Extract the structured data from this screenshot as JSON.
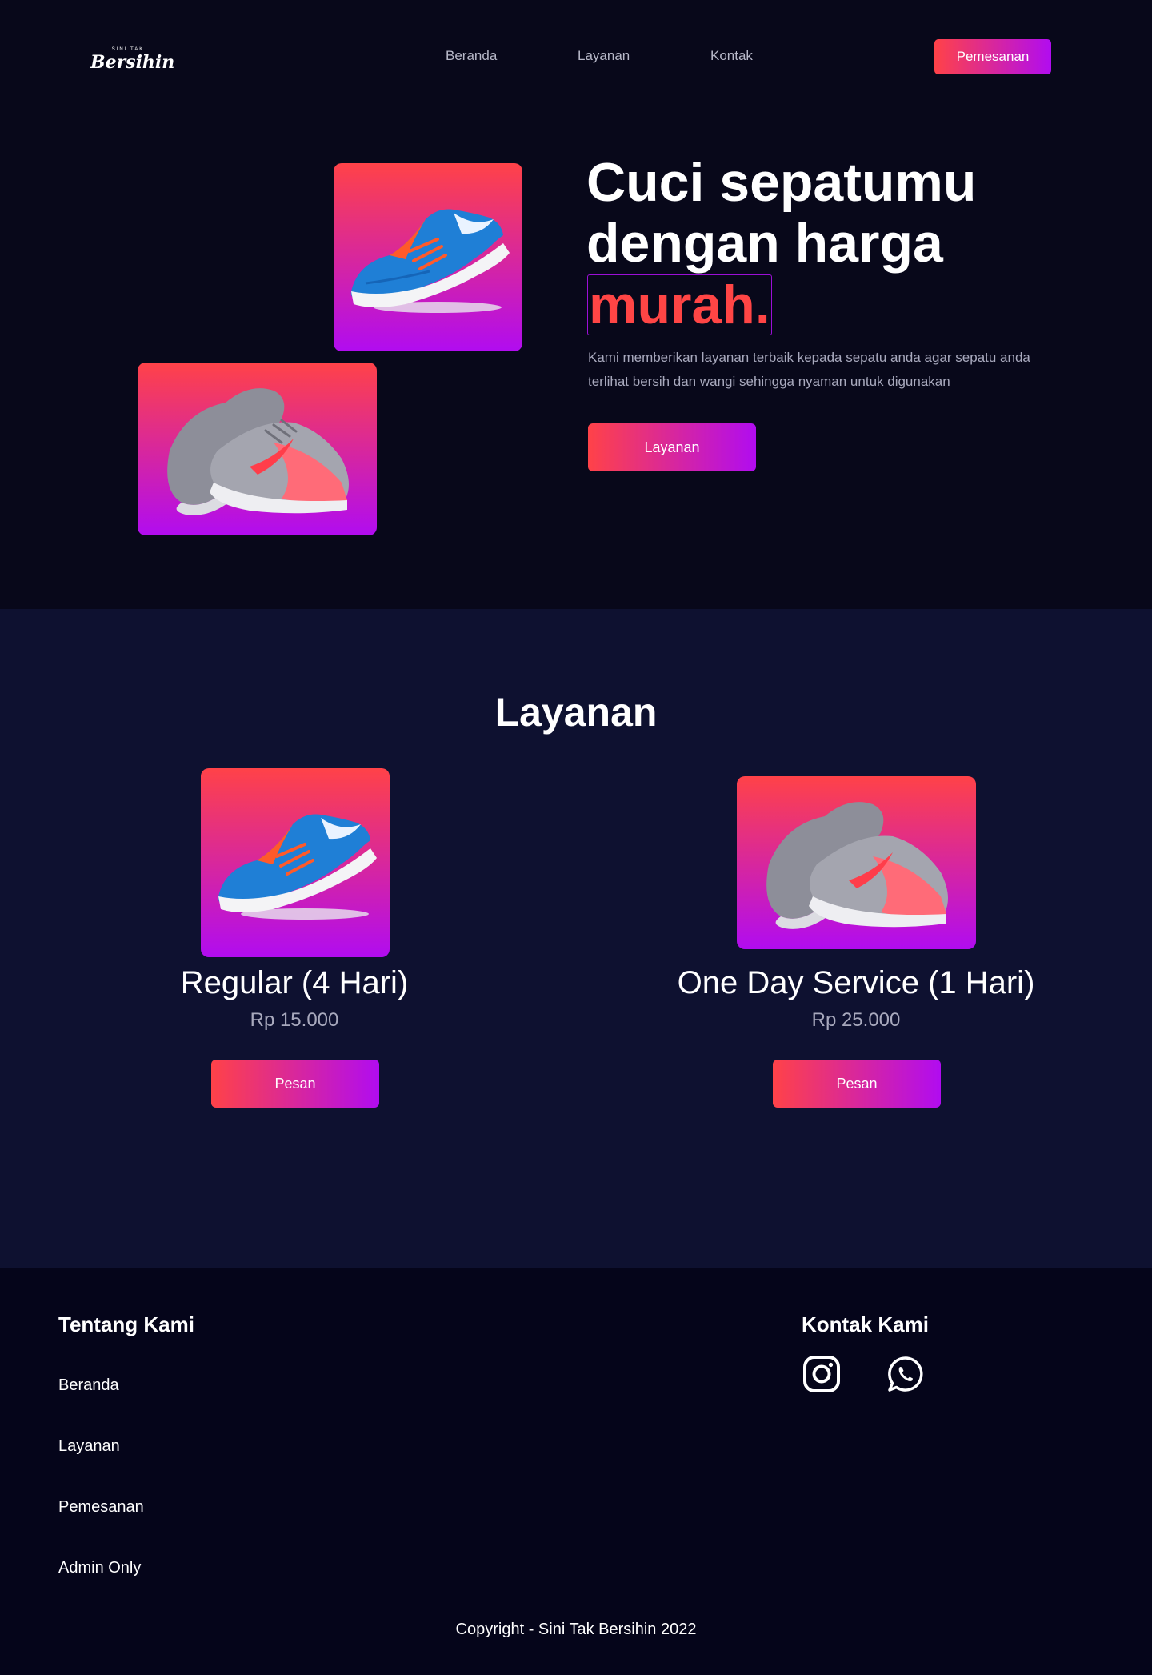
{
  "nav": {
    "logo_top": "SINI TAK",
    "logo_main": "Bersihin",
    "links": [
      "Beranda",
      "Layanan",
      "Kontak"
    ],
    "order_label": "Pemesanan"
  },
  "hero": {
    "title_line1": "Cuci sepatumu",
    "title_line2": "dengan harga",
    "highlight": "murah.",
    "description": "Kami memberikan layanan terbaik kepada sepatu anda agar sepatu anda terlihat bersih dan wangi sehingga nyaman untuk digunakan",
    "button_label": "Layanan"
  },
  "services": {
    "title": "Layanan",
    "items": [
      {
        "name": "Regular (4 Hari)",
        "price": "Rp 15.000",
        "button": "Pesan",
        "image": "blue-running-shoe"
      },
      {
        "name": "One Day Service (1 Hari)",
        "price": "Rp 25.000",
        "button": "Pesan",
        "image": "grey-pink-shoes"
      }
    ]
  },
  "footer": {
    "about_title": "Tentang Kami",
    "links": [
      "Beranda",
      "Layanan",
      "Pemesanan",
      "Admin Only"
    ],
    "contact_title": "Kontak Kami",
    "icons": [
      "instagram-icon",
      "whatsapp-icon"
    ],
    "copyright": "Copyright - Sini Tak Bersihin 2022"
  },
  "colors": {
    "background": "#08081a",
    "services_bg": "#0e1130",
    "gradient_start": "#ff4248",
    "gradient_end": "#b10cf0",
    "highlight": "#ff4545"
  }
}
